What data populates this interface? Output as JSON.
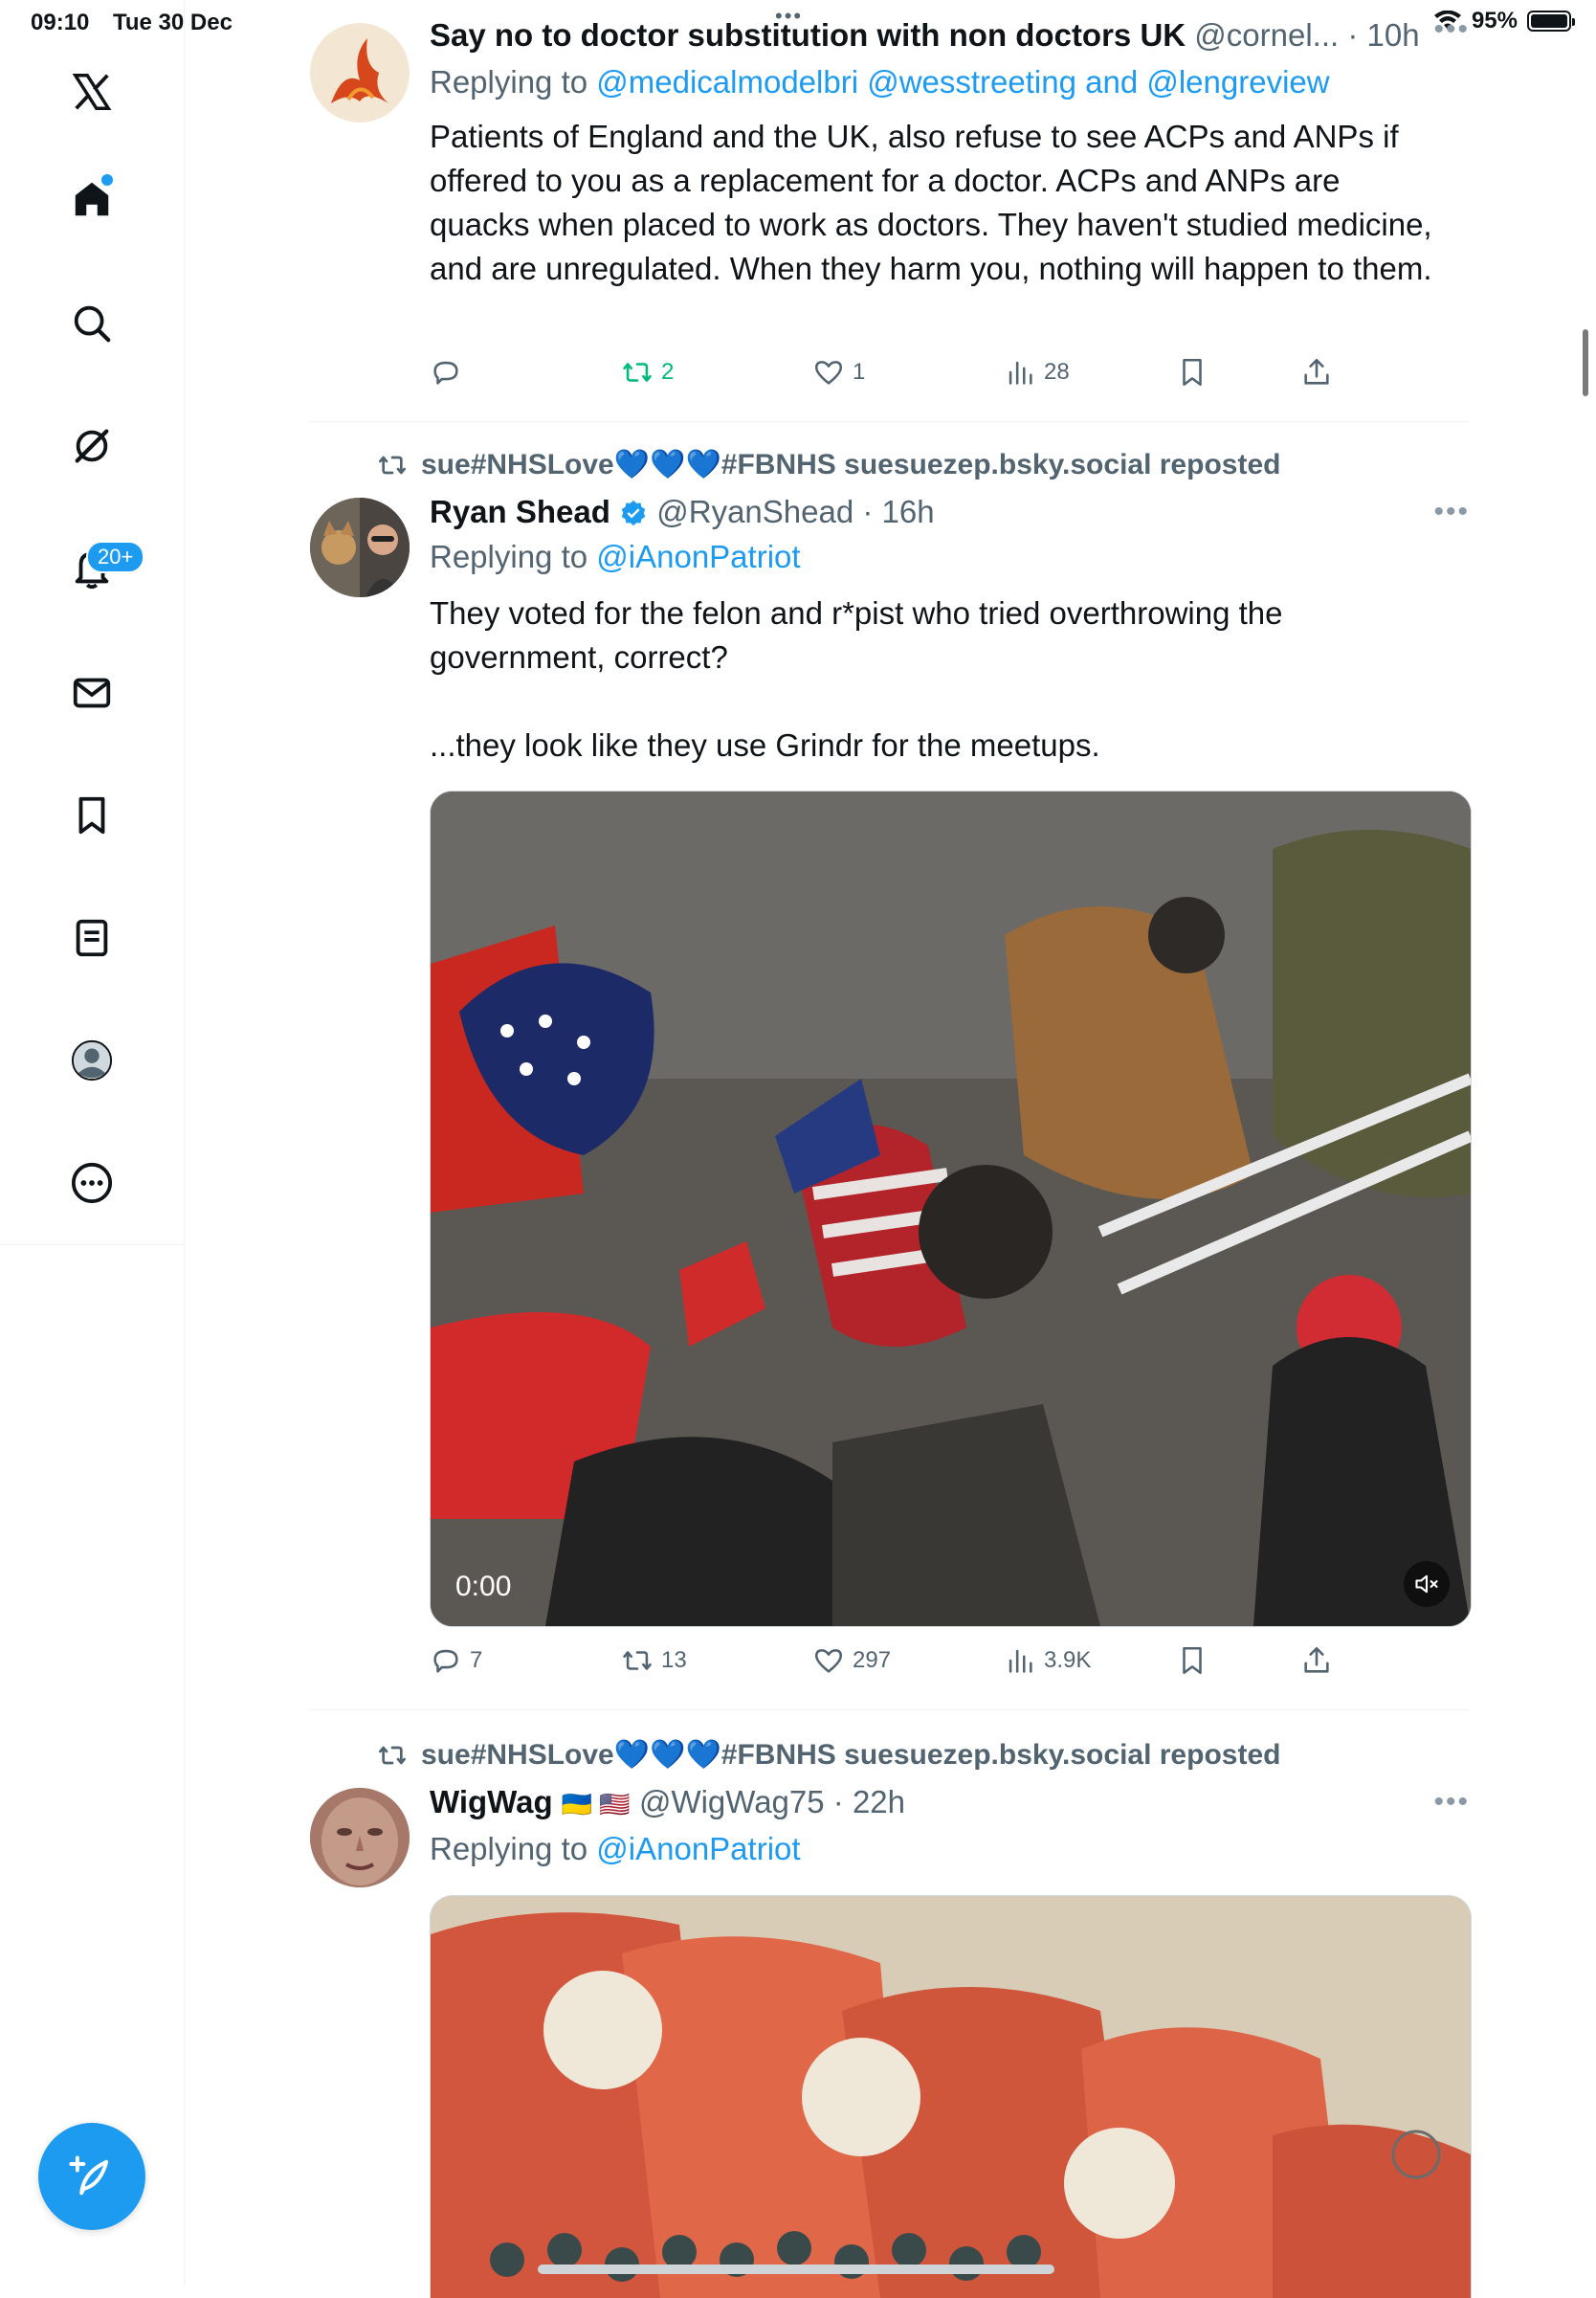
{
  "status_bar": {
    "time": "09:10",
    "date": "Tue 30 Dec",
    "battery": "95%"
  },
  "sidebar": {
    "items": [
      {
        "name": "x-logo-icon"
      },
      {
        "name": "home-icon"
      },
      {
        "name": "search-icon"
      },
      {
        "name": "grok-icon"
      },
      {
        "name": "notifications-icon",
        "badge": "20+"
      },
      {
        "name": "messages-icon"
      },
      {
        "name": "bookmarks-icon"
      },
      {
        "name": "lists-icon"
      },
      {
        "name": "profile-icon"
      },
      {
        "name": "more-icon"
      }
    ],
    "compose_icon": "compose-icon"
  },
  "tweets": [
    {
      "name": "Say no to doctor substitution with non doctors UK",
      "handle": "@cornel... · 10h",
      "reply_prefix": "Replying to ",
      "reply_links": "@medicalmodelbri @wesstreeting and @lengreview",
      "text": "Patients of England and the UK, also refuse to see ACPs and ANPs if offered to you as a replacement for a doctor. ACPs and ANPs are quacks when placed to work as doctors. They haven't studied medicine, and are unregulated. When they harm you, nothing will happen to them.",
      "replies": "",
      "reposts": "2",
      "likes": "1",
      "views": "28"
    },
    {
      "reposted_by": "sue#NHSLove💙💙💙#FBNHS suesuezep.bsky.social reposted",
      "name": "Ryan Shead",
      "handle": "@RyanShead · 16h",
      "reply_prefix": "Replying to ",
      "reply_links": "@iAnonPatriot",
      "text": "They voted for the felon and r*pist who tried overthrowing the government, correct?\n\n...they look like they use Grindr for the meetups.",
      "video_time": "0:00",
      "replies": "7",
      "reposts": "13",
      "likes": "297",
      "views": "3.9K"
    },
    {
      "reposted_by": "sue#NHSLove💙💙💙#FBNHS suesuezep.bsky.social reposted",
      "name": "WigWag",
      "flags": "🇺🇦 🇺🇸",
      "handle": "@WigWag75 · 22h",
      "reply_prefix": "Replying to ",
      "reply_links": "@iAnonPatriot"
    }
  ],
  "colors": {
    "accent": "#1d9bf0",
    "repost_green": "#00ba7c",
    "muted": "#536471"
  }
}
